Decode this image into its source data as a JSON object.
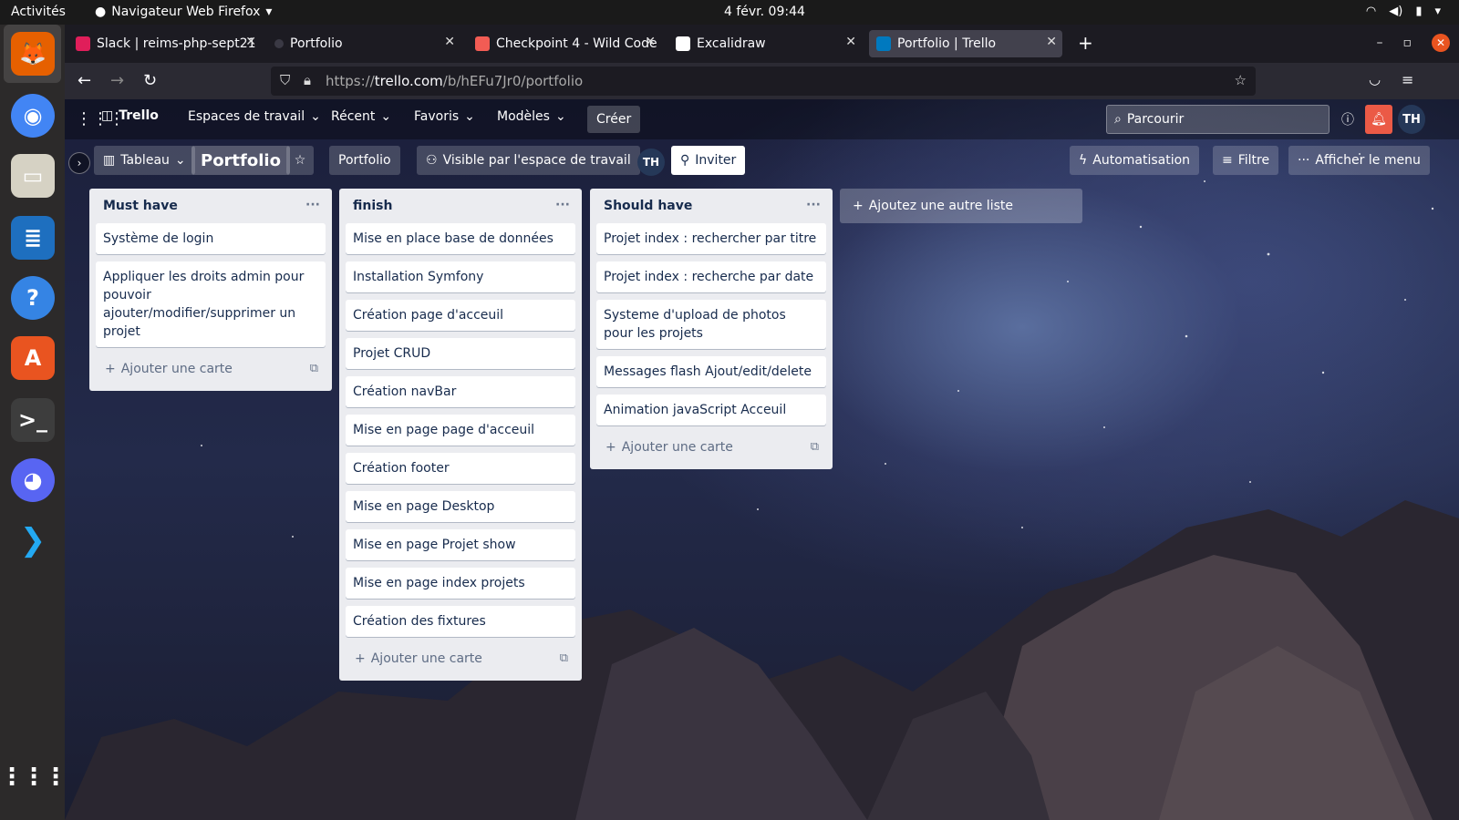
{
  "os": {
    "activities": "Activités",
    "app_name": "Navigateur Web Firefox",
    "clock": "4 févr.  09:44"
  },
  "dock": [
    {
      "name": "firefox-icon",
      "color": "#e66000",
      "glyph": "🦊"
    },
    {
      "name": "chrome-icon",
      "color": "#4285f4",
      "glyph": "◉"
    },
    {
      "name": "files-icon",
      "color": "#d6d2c4",
      "glyph": "▭"
    },
    {
      "name": "writer-icon",
      "color": "#1e6fbf",
      "glyph": "≣"
    },
    {
      "name": "help-icon",
      "color": "#3584e4",
      "glyph": "?"
    },
    {
      "name": "software-icon",
      "color": "#e95420",
      "glyph": "A"
    },
    {
      "name": "terminal-icon",
      "color": "#3d3d3d",
      "glyph": ">_"
    },
    {
      "name": "discord-icon",
      "color": "#5865f2",
      "glyph": "◕"
    },
    {
      "name": "vscode-icon",
      "color": "#23a9f2",
      "glyph": "❯"
    }
  ],
  "browser": {
    "tabs": [
      {
        "label": "Slack | reims-php-sept21",
        "color": "#e01e5a"
      },
      {
        "label": "Portfolio",
        "color": "#1c1b22"
      },
      {
        "label": "Checkpoint 4 - Wild Code",
        "color": "#f25c54"
      },
      {
        "label": "Excalidraw",
        "color": "#ffffff"
      },
      {
        "label": "Portfolio | Trello",
        "color": "#0079bf"
      }
    ],
    "url_prefix": "https://",
    "url_host": "trello.com",
    "url_path": "/b/hEFu7Jr0/portfolio"
  },
  "trello": {
    "logo": "Trello",
    "nav": [
      "Espaces de travail",
      "Récent",
      "Favoris",
      "Modèles"
    ],
    "create": "Créer",
    "search_placeholder": "Parcourir",
    "user_initials": "TH",
    "board": {
      "view": "Tableau",
      "title": "Portfolio",
      "workspace": "Portfolio",
      "visibility": "Visible par l'espace de travail",
      "invite": "Inviter",
      "automation": "Automatisation",
      "filter": "Filtre",
      "menu": "Afficher le menu"
    },
    "lists": [
      {
        "title": "Must have",
        "cards": [
          "Système de login",
          "Appliquer les droits admin pour pouvoir ajouter/modifier/supprimer un projet"
        ]
      },
      {
        "title": "finish",
        "cards": [
          "Mise en place base de données",
          "Installation Symfony",
          "Création page d'acceuil",
          "Projet CRUD",
          "Création navBar",
          "Mise en page page d'acceuil",
          "Création footer",
          "Mise en page Desktop",
          "Mise en page Projet show",
          "Mise en page index projets",
          "Création des fixtures"
        ]
      },
      {
        "title": "Should have",
        "cards": [
          "Projet index : rechercher par titre",
          "Projet index : recherche par date",
          "Systeme d'upload de photos pour les projets",
          "Messages flash Ajout/edit/delete",
          "Animation javaScript Acceuil"
        ]
      }
    ],
    "add_card": "Ajouter une carte",
    "add_list": "Ajoutez une autre liste"
  }
}
